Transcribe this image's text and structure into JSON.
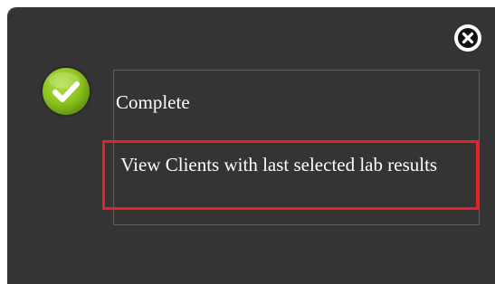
{
  "dialog": {
    "close_icon": "close-icon",
    "status_icon": "check-circle-icon",
    "status_text": "Complete",
    "link_text": " View Clients with last selected lab results",
    "colors": {
      "background": "#343434",
      "highlight_border": "#e8202a",
      "success_green": "#8bc21c",
      "text": "#ffffff"
    }
  }
}
